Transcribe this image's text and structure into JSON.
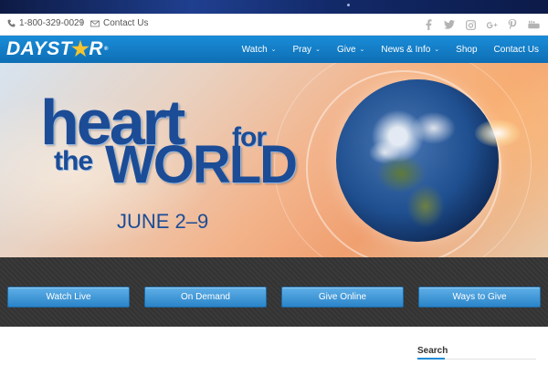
{
  "utility_bar": {
    "phone": "1-800-329-0029",
    "separator": "/",
    "contact": "Contact Us",
    "phone_icon": "phone-icon",
    "contact_icon": "envelope-icon",
    "social": [
      {
        "name": "facebook-icon",
        "glyph": "f"
      },
      {
        "name": "twitter-icon",
        "glyph": "t"
      },
      {
        "name": "instagram-icon",
        "glyph": "i"
      },
      {
        "name": "google-plus-icon",
        "glyph": "g+"
      },
      {
        "name": "pinterest-icon",
        "glyph": "p"
      },
      {
        "name": "youtube-icon",
        "glyph": "yt"
      }
    ]
  },
  "header": {
    "logo_left": "DAY",
    "logo_star": "★",
    "logo_right": "R",
    "logo_reg": "®",
    "nav": [
      {
        "label": "Watch",
        "dropdown": true
      },
      {
        "label": "Pray",
        "dropdown": true
      },
      {
        "label": "Give",
        "dropdown": true
      },
      {
        "label": "News & Info",
        "dropdown": true
      },
      {
        "label": "Shop",
        "dropdown": false
      },
      {
        "label": "Contact Us",
        "dropdown": false
      }
    ],
    "chevron": "⌄"
  },
  "banner": {
    "line1": "heart",
    "line1b": "for",
    "line2a": "the",
    "line2b": "WORLD",
    "date": "JUNE 2–9"
  },
  "actions": {
    "watch_live": "Watch Live",
    "on_demand": "On Demand",
    "give_online": "Give Online",
    "ways_to_give": "Ways to Give"
  },
  "sidebar": {
    "search_title": "Search"
  },
  "colors": {
    "nav_blue": "#1a8cd8",
    "button_blue": "#2a84c8",
    "banner_text": "#1c4c96",
    "band_dark": "#333333"
  }
}
